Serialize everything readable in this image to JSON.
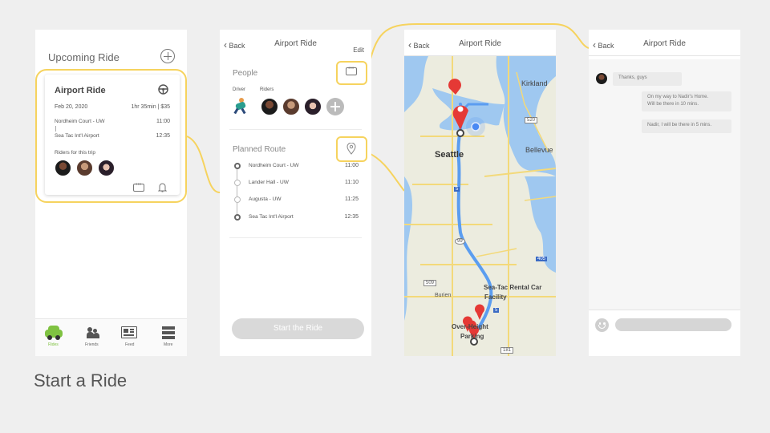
{
  "slide_caption": "Start a Ride",
  "screen1": {
    "title": "Upcoming Ride",
    "card": {
      "title": "Airport Ride",
      "date": "Feb 20, 2020",
      "duration_price": "1hr 35min  |  $35",
      "stop1": "Nordheim Court - UW",
      "time1": "11:00",
      "stop2": "Sea Tac Int'l Airport",
      "time2": "12:35",
      "riders_label": "Riders for this trip"
    },
    "tabs": [
      {
        "label": "Rides"
      },
      {
        "label": "Friends"
      },
      {
        "label": "Feed"
      },
      {
        "label": "More"
      }
    ],
    "accent": "#7fc241"
  },
  "screen2": {
    "back": "Back",
    "title": "Airport Ride",
    "edit": "Edit",
    "people_heading": "People",
    "driver_label": "Driver",
    "riders_label": "Riders",
    "route_heading": "Planned Route",
    "stops": [
      {
        "name": "Nordheim Court - UW",
        "time": "11:00"
      },
      {
        "name": "Lander Hall - UW",
        "time": "11:10"
      },
      {
        "name": "Augusta - UW",
        "time": "11:25"
      },
      {
        "name": "Sea Tac Int'l Airport",
        "time": "12:35"
      }
    ],
    "start_button": "Start the Ride"
  },
  "screen3": {
    "back": "Back",
    "title": "Airport Ride",
    "map_labels": {
      "kirkland": "Kirkland",
      "seattle": "Seattle",
      "bellevue": "Bellevue",
      "burien": "Burien",
      "seatac_rental": "Sea-Tac Rental Car",
      "facility": "Facility",
      "overheight": "Over-Height",
      "parking": "Parking",
      "hwy520": "520",
      "hwy5": "5",
      "hwy99": "99",
      "hwy405": "405",
      "hwy509": "509",
      "hwy5b": "5",
      "hwy181": "181"
    }
  },
  "screen4": {
    "back": "Back",
    "title": "Airport Ride",
    "messages": [
      {
        "text": "Thanks, guys"
      },
      {
        "text1": "On my way to Nadir's Home.",
        "text2": "Will be there in 10 mins."
      },
      {
        "text": "Nadir, I will be there in 5 mins."
      }
    ]
  },
  "highlight_color": "#f6d35e"
}
